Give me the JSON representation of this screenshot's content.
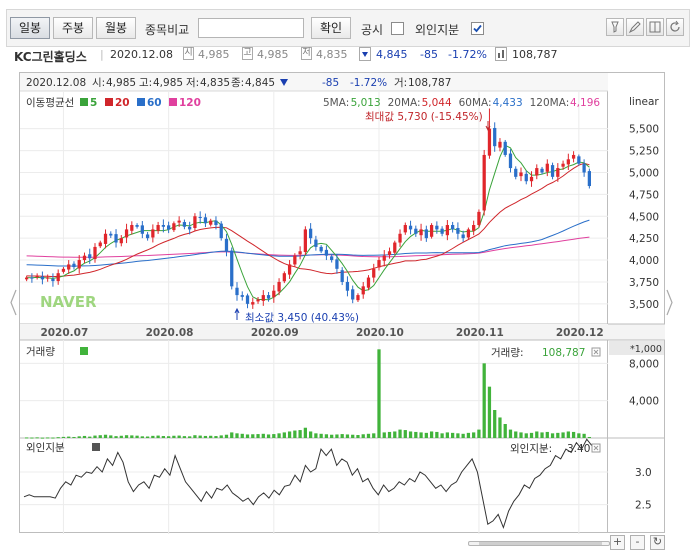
{
  "toolbar": {
    "tabs": [
      {
        "label": "일봉",
        "active": true
      },
      {
        "label": "주봉",
        "active": false
      },
      {
        "label": "월봉",
        "active": false
      }
    ],
    "compare_label": "종목비교",
    "compare_input_value": "",
    "confirm_button": "확인",
    "disclosure_label": "공시",
    "disclosure_checked": false,
    "foreign_label": "외인지분",
    "foreign_checked": true,
    "tool_icons": [
      "indicator-settings-icon",
      "draw-tool-icon",
      "split-view-icon",
      "refresh-icon"
    ]
  },
  "info": {
    "name": "KC그린홀딩스",
    "date": "2020.12.08",
    "open_icon": "시",
    "open": "4,985",
    "high_icon": "고",
    "high": "4,985",
    "low_icon": "저",
    "low": "4,835",
    "close": "4,845",
    "change": "-85",
    "change_pct": "-1.72%",
    "volume": "108,787",
    "down_color": "#1a3fb0"
  },
  "chart_header": {
    "date": "2020.12.08",
    "open_label": "시:",
    "open": "4,985",
    "high_label": "고:",
    "high": "4,985",
    "low_label": "저:",
    "low": "4,835",
    "close_label": "종:",
    "close": "4,845",
    "change": "-85",
    "change_pct": "-1.72%",
    "volume_label": "거:",
    "volume": "108,787",
    "scale_mode": "linear",
    "ma_title": "이동평균선",
    "ma_legend": [
      {
        "label": "5",
        "color": "#3aa33a"
      },
      {
        "label": "20",
        "color": "#d0262b"
      },
      {
        "label": "60",
        "color": "#2a6fc9"
      },
      {
        "label": "120",
        "color": "#e0409e"
      }
    ],
    "ma_values": [
      {
        "label": "5MA:",
        "value": "5,013",
        "color": "#3aa33a"
      },
      {
        "label": "20MA:",
        "value": "5,044",
        "color": "#d0262b"
      },
      {
        "label": "60MA:",
        "value": "4,433",
        "color": "#2a6fc9"
      },
      {
        "label": "120MA:",
        "value": "4,196",
        "color": "#e0409e"
      }
    ],
    "max_annotation": "최대값 5,730 (-15.45%)",
    "min_annotation": "최소값 3,450 (40.43%)",
    "watermark": "NAVER",
    "x_labels": [
      "2020.07",
      "2020.08",
      "2020.09",
      "2020.10",
      "2020.11",
      "2020.12"
    ]
  },
  "volume_panel": {
    "title": "거래량",
    "legend_label": "거래량:",
    "value": "108,787",
    "unit": "*1,000",
    "color": "#41b33b"
  },
  "foreign_panel": {
    "title": "외인지분",
    "legend_label": "외인지분:",
    "value": "3.40",
    "color": "#555555"
  },
  "scrollbar_buttons": [
    "+",
    "-",
    "↻"
  ],
  "chart_data": [
    {
      "type": "candlestick",
      "title": "KC그린홀딩스",
      "x_labels": [
        "2020.07",
        "2020.08",
        "2020.09",
        "2020.10",
        "2020.11",
        "2020.12"
      ],
      "y_ticks": [
        3500,
        3750,
        4000,
        4250,
        4500,
        4750,
        5000,
        5250,
        5500
      ],
      "y_tick_labels": [
        "3,500",
        "3,750",
        "4,000",
        "4,250",
        "4,500",
        "4,750",
        "5,000",
        "5,250",
        "5,500"
      ],
      "ylim": [
        3270,
        5930
      ],
      "scale": "linear",
      "grid": true,
      "up_color": "#e0262b",
      "down_color": "#2a6fc9",
      "close": [
        3800,
        3790,
        3820,
        3780,
        3800,
        3760,
        3850,
        3900,
        3950,
        3920,
        4000,
        4050,
        4020,
        4150,
        4200,
        4300,
        4280,
        4200,
        4250,
        4350,
        4400,
        4380,
        4300,
        4250,
        4350,
        4400,
        4380,
        4350,
        4420,
        4450,
        4380,
        4350,
        4500,
        4480,
        4420,
        4450,
        4400,
        4250,
        4100,
        3700,
        3600,
        3580,
        3500,
        3520,
        3550,
        3600,
        3560,
        3650,
        3750,
        3850,
        3950,
        4050,
        4100,
        4350,
        4250,
        4150,
        4100,
        4050,
        4000,
        3900,
        3750,
        3650,
        3550,
        3600,
        3700,
        3800,
        3900,
        4000,
        4050,
        4100,
        4200,
        4300,
        4400,
        4350,
        4300,
        4350,
        4250,
        4400,
        4350,
        4300,
        4400,
        4350,
        4300,
        4250,
        4350,
        4400,
        4550,
        5200,
        5500,
        5300,
        5350,
        5200,
        5050,
        4950,
        5000,
        4900,
        4950,
        5050,
        5000,
        5100,
        4950,
        5050,
        5100,
        5150,
        5200,
        5100,
        5000,
        4845
      ],
      "highs_note": "max 5,730 near 2020.11, min 3,450 near 2020.09",
      "max_value": 5730,
      "min_value": 3450,
      "moving_averages": [
        {
          "name": "5MA",
          "latest": 5013
        },
        {
          "name": "20MA",
          "latest": 5044
        },
        {
          "name": "60MA",
          "latest": 4433
        },
        {
          "name": "120MA",
          "latest": 4196
        }
      ]
    },
    {
      "type": "bar",
      "title": "거래량",
      "unit": "*1,000",
      "y_ticks": [
        4000,
        8000
      ],
      "y_tick_labels": [
        "4,000",
        "8,000"
      ],
      "ylim": [
        0,
        10500
      ],
      "values": [
        60,
        50,
        70,
        40,
        60,
        50,
        90,
        120,
        150,
        110,
        180,
        220,
        150,
        260,
        300,
        350,
        280,
        200,
        240,
        300,
        280,
        250,
        180,
        160,
        230,
        260,
        210,
        190,
        240,
        260,
        200,
        180,
        300,
        260,
        220,
        240,
        210,
        280,
        350,
        600,
        500,
        450,
        380,
        400,
        420,
        450,
        380,
        420,
        500,
        600,
        700,
        800,
        850,
        1100,
        700,
        500,
        450,
        400,
        350,
        380,
        420,
        380,
        350,
        320,
        400,
        450,
        500,
        9500,
        600,
        650,
        700,
        900,
        850,
        700,
        650,
        600,
        550,
        700,
        650,
        500,
        600,
        550,
        500,
        450,
        550,
        600,
        900,
        8000,
        5500,
        3000,
        2200,
        1500,
        900,
        700,
        600,
        500,
        550,
        700,
        600,
        650,
        500,
        550,
        600,
        700,
        650,
        500,
        450,
        108.787
      ]
    },
    {
      "type": "line",
      "title": "외인지분",
      "y_ticks": [
        2.5,
        3.0
      ],
      "y_tick_labels": [
        "2.5",
        "3.0"
      ],
      "ylim": [
        2.05,
        3.52
      ],
      "values": [
        2.62,
        2.65,
        2.62,
        2.62,
        2.62,
        2.62,
        2.6,
        2.75,
        2.85,
        2.8,
        2.95,
        2.92,
        3.0,
        2.98,
        3.08,
        3.0,
        3.2,
        3.1,
        3.3,
        3.15,
        2.85,
        2.7,
        2.8,
        2.85,
        2.75,
        2.95,
        2.92,
        3.05,
        2.95,
        3.25,
        3.05,
        2.85,
        2.75,
        2.65,
        2.55,
        2.7,
        2.6,
        2.75,
        2.72,
        2.8,
        2.68,
        2.62,
        2.55,
        2.6,
        2.5,
        2.62,
        2.68,
        2.6,
        2.72,
        2.65,
        2.78,
        2.8,
        2.95,
        2.85,
        3.1,
        3.0,
        3.05,
        3.35,
        3.25,
        3.35,
        3.1,
        3.2,
        3.15,
        2.95,
        3.05,
        2.85,
        2.9,
        2.75,
        2.65,
        2.8,
        2.7,
        2.75,
        2.85,
        2.8,
        2.9,
        2.85,
        3.0,
        2.95,
        2.85,
        2.75,
        2.8,
        2.7,
        2.8,
        2.85,
        3.0,
        3.1,
        3.2,
        3.0,
        2.6,
        2.2,
        2.25,
        2.35,
        2.15,
        2.4,
        2.55,
        2.65,
        2.8,
        2.75,
        2.9,
        2.95,
        3.05,
        3.1,
        3.25,
        3.2,
        3.35,
        3.3,
        3.45,
        3.35,
        3.5,
        3.4
      ]
    }
  ]
}
